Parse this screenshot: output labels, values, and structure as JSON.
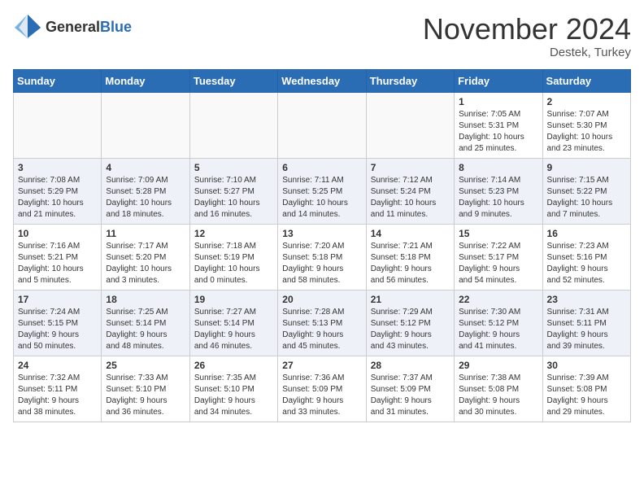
{
  "header": {
    "logo_line1": "General",
    "logo_line2": "Blue",
    "month_title": "November 2024",
    "location": "Destek, Turkey"
  },
  "weekdays": [
    "Sunday",
    "Monday",
    "Tuesday",
    "Wednesday",
    "Thursday",
    "Friday",
    "Saturday"
  ],
  "weeks": [
    [
      {
        "day": "",
        "info": ""
      },
      {
        "day": "",
        "info": ""
      },
      {
        "day": "",
        "info": ""
      },
      {
        "day": "",
        "info": ""
      },
      {
        "day": "",
        "info": ""
      },
      {
        "day": "1",
        "info": "Sunrise: 7:05 AM\nSunset: 5:31 PM\nDaylight: 10 hours\nand 25 minutes."
      },
      {
        "day": "2",
        "info": "Sunrise: 7:07 AM\nSunset: 5:30 PM\nDaylight: 10 hours\nand 23 minutes."
      }
    ],
    [
      {
        "day": "3",
        "info": "Sunrise: 7:08 AM\nSunset: 5:29 PM\nDaylight: 10 hours\nand 21 minutes."
      },
      {
        "day": "4",
        "info": "Sunrise: 7:09 AM\nSunset: 5:28 PM\nDaylight: 10 hours\nand 18 minutes."
      },
      {
        "day": "5",
        "info": "Sunrise: 7:10 AM\nSunset: 5:27 PM\nDaylight: 10 hours\nand 16 minutes."
      },
      {
        "day": "6",
        "info": "Sunrise: 7:11 AM\nSunset: 5:25 PM\nDaylight: 10 hours\nand 14 minutes."
      },
      {
        "day": "7",
        "info": "Sunrise: 7:12 AM\nSunset: 5:24 PM\nDaylight: 10 hours\nand 11 minutes."
      },
      {
        "day": "8",
        "info": "Sunrise: 7:14 AM\nSunset: 5:23 PM\nDaylight: 10 hours\nand 9 minutes."
      },
      {
        "day": "9",
        "info": "Sunrise: 7:15 AM\nSunset: 5:22 PM\nDaylight: 10 hours\nand 7 minutes."
      }
    ],
    [
      {
        "day": "10",
        "info": "Sunrise: 7:16 AM\nSunset: 5:21 PM\nDaylight: 10 hours\nand 5 minutes."
      },
      {
        "day": "11",
        "info": "Sunrise: 7:17 AM\nSunset: 5:20 PM\nDaylight: 10 hours\nand 3 minutes."
      },
      {
        "day": "12",
        "info": "Sunrise: 7:18 AM\nSunset: 5:19 PM\nDaylight: 10 hours\nand 0 minutes."
      },
      {
        "day": "13",
        "info": "Sunrise: 7:20 AM\nSunset: 5:18 PM\nDaylight: 9 hours\nand 58 minutes."
      },
      {
        "day": "14",
        "info": "Sunrise: 7:21 AM\nSunset: 5:18 PM\nDaylight: 9 hours\nand 56 minutes."
      },
      {
        "day": "15",
        "info": "Sunrise: 7:22 AM\nSunset: 5:17 PM\nDaylight: 9 hours\nand 54 minutes."
      },
      {
        "day": "16",
        "info": "Sunrise: 7:23 AM\nSunset: 5:16 PM\nDaylight: 9 hours\nand 52 minutes."
      }
    ],
    [
      {
        "day": "17",
        "info": "Sunrise: 7:24 AM\nSunset: 5:15 PM\nDaylight: 9 hours\nand 50 minutes."
      },
      {
        "day": "18",
        "info": "Sunrise: 7:25 AM\nSunset: 5:14 PM\nDaylight: 9 hours\nand 48 minutes."
      },
      {
        "day": "19",
        "info": "Sunrise: 7:27 AM\nSunset: 5:14 PM\nDaylight: 9 hours\nand 46 minutes."
      },
      {
        "day": "20",
        "info": "Sunrise: 7:28 AM\nSunset: 5:13 PM\nDaylight: 9 hours\nand 45 minutes."
      },
      {
        "day": "21",
        "info": "Sunrise: 7:29 AM\nSunset: 5:12 PM\nDaylight: 9 hours\nand 43 minutes."
      },
      {
        "day": "22",
        "info": "Sunrise: 7:30 AM\nSunset: 5:12 PM\nDaylight: 9 hours\nand 41 minutes."
      },
      {
        "day": "23",
        "info": "Sunrise: 7:31 AM\nSunset: 5:11 PM\nDaylight: 9 hours\nand 39 minutes."
      }
    ],
    [
      {
        "day": "24",
        "info": "Sunrise: 7:32 AM\nSunset: 5:11 PM\nDaylight: 9 hours\nand 38 minutes."
      },
      {
        "day": "25",
        "info": "Sunrise: 7:33 AM\nSunset: 5:10 PM\nDaylight: 9 hours\nand 36 minutes."
      },
      {
        "day": "26",
        "info": "Sunrise: 7:35 AM\nSunset: 5:10 PM\nDaylight: 9 hours\nand 34 minutes."
      },
      {
        "day": "27",
        "info": "Sunrise: 7:36 AM\nSunset: 5:09 PM\nDaylight: 9 hours\nand 33 minutes."
      },
      {
        "day": "28",
        "info": "Sunrise: 7:37 AM\nSunset: 5:09 PM\nDaylight: 9 hours\nand 31 minutes."
      },
      {
        "day": "29",
        "info": "Sunrise: 7:38 AM\nSunset: 5:08 PM\nDaylight: 9 hours\nand 30 minutes."
      },
      {
        "day": "30",
        "info": "Sunrise: 7:39 AM\nSunset: 5:08 PM\nDaylight: 9 hours\nand 29 minutes."
      }
    ]
  ]
}
